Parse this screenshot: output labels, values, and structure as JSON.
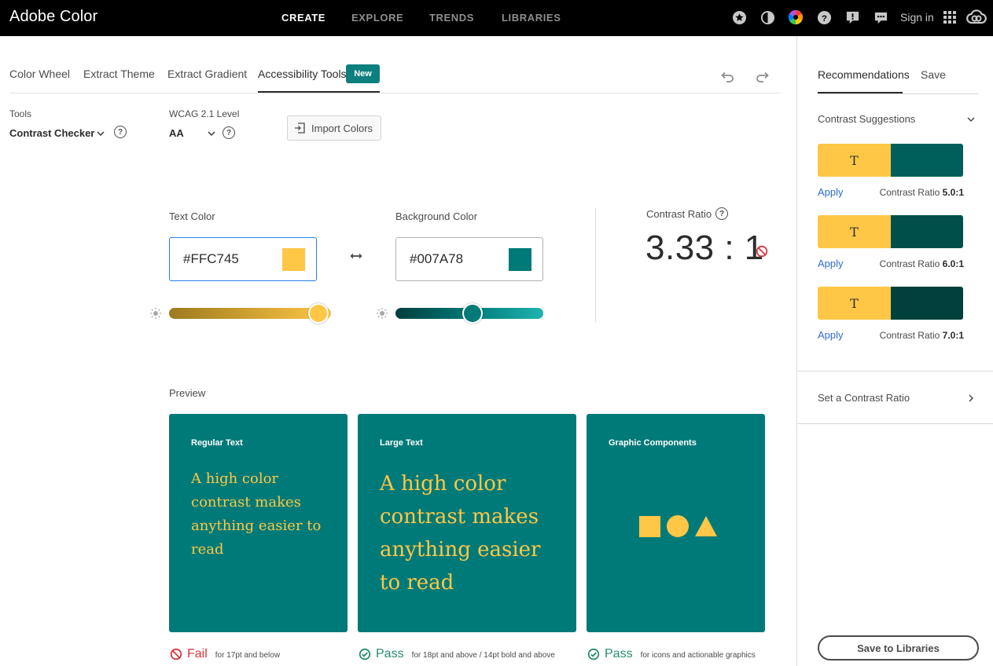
{
  "app": {
    "brand": "Adobe Color"
  },
  "nav": {
    "items": [
      {
        "label": "CREATE",
        "active": true
      },
      {
        "label": "EXPLORE",
        "active": false
      },
      {
        "label": "TRENDS",
        "active": false
      },
      {
        "label": "LIBRARIES",
        "active": false
      }
    ],
    "icons": [
      "star-icon",
      "moon-icon",
      "color-wheel-icon",
      "help-icon",
      "feedback-icon",
      "chat-icon"
    ],
    "signin": "Sign in",
    "apps_icon": "apps-grid-icon",
    "cc_icon": "creative-cloud-icon"
  },
  "tabs": {
    "items": [
      "Color Wheel",
      "Extract Theme",
      "Extract Gradient",
      "Accessibility Tools"
    ],
    "active": "Accessibility Tools",
    "badge": "New"
  },
  "tools": {
    "tools_label": "Tools",
    "tool_value": "Contrast Checker",
    "wcag_label": "WCAG 2.1 Level",
    "wcag_value": "AA",
    "import_label": "Import Colors"
  },
  "checker": {
    "text_color_label": "Text Color",
    "text_color_value": "#FFC745",
    "text_color_hex": "#FFC745",
    "bg_color_label": "Background Color",
    "bg_color_value": "#007A78",
    "bg_color_hex": "#007A78",
    "text_brightness": 0.92,
    "bg_brightness": 0.52,
    "ratio_label": "Contrast Ratio",
    "ratio_value": "3.33 : 1"
  },
  "preview": {
    "label": "Preview",
    "cards": [
      {
        "title": "Regular Text",
        "body": "A high color contrast makes anything easier to read"
      },
      {
        "title": "Large Text",
        "body": "A high color contrast makes anything easier to read"
      },
      {
        "title": "Graphic Components"
      }
    ],
    "results": [
      {
        "status": "Fail",
        "note": "for 17pt and below"
      },
      {
        "status": "Pass",
        "note": "for 18pt and above / 14pt bold and above"
      },
      {
        "status": "Pass",
        "note": "for icons and actionable graphics"
      }
    ]
  },
  "panel": {
    "tabs": [
      "Recommendations",
      "Save"
    ],
    "suggestions_title": "Contrast Suggestions",
    "suggestions": [
      {
        "letter": "T",
        "bg": "#005F5B",
        "apply": "Apply",
        "ratio_label": "Contrast Ratio",
        "ratio": "5.0:1"
      },
      {
        "letter": "T",
        "bg": "#004F4B",
        "apply": "Apply",
        "ratio_label": "Contrast Ratio",
        "ratio": "6.0:1"
      },
      {
        "letter": "T",
        "bg": "#00413D",
        "apply": "Apply",
        "ratio_label": "Contrast Ratio",
        "ratio": "7.0:1"
      }
    ],
    "set_ratio": "Set a Contrast Ratio",
    "save_libraries": "Save to Libraries"
  },
  "colors": {
    "text": "#FFC745",
    "background": "#007A78",
    "fail": "#d7373f",
    "pass": "#268e6c",
    "link": "#2c6bd6"
  }
}
